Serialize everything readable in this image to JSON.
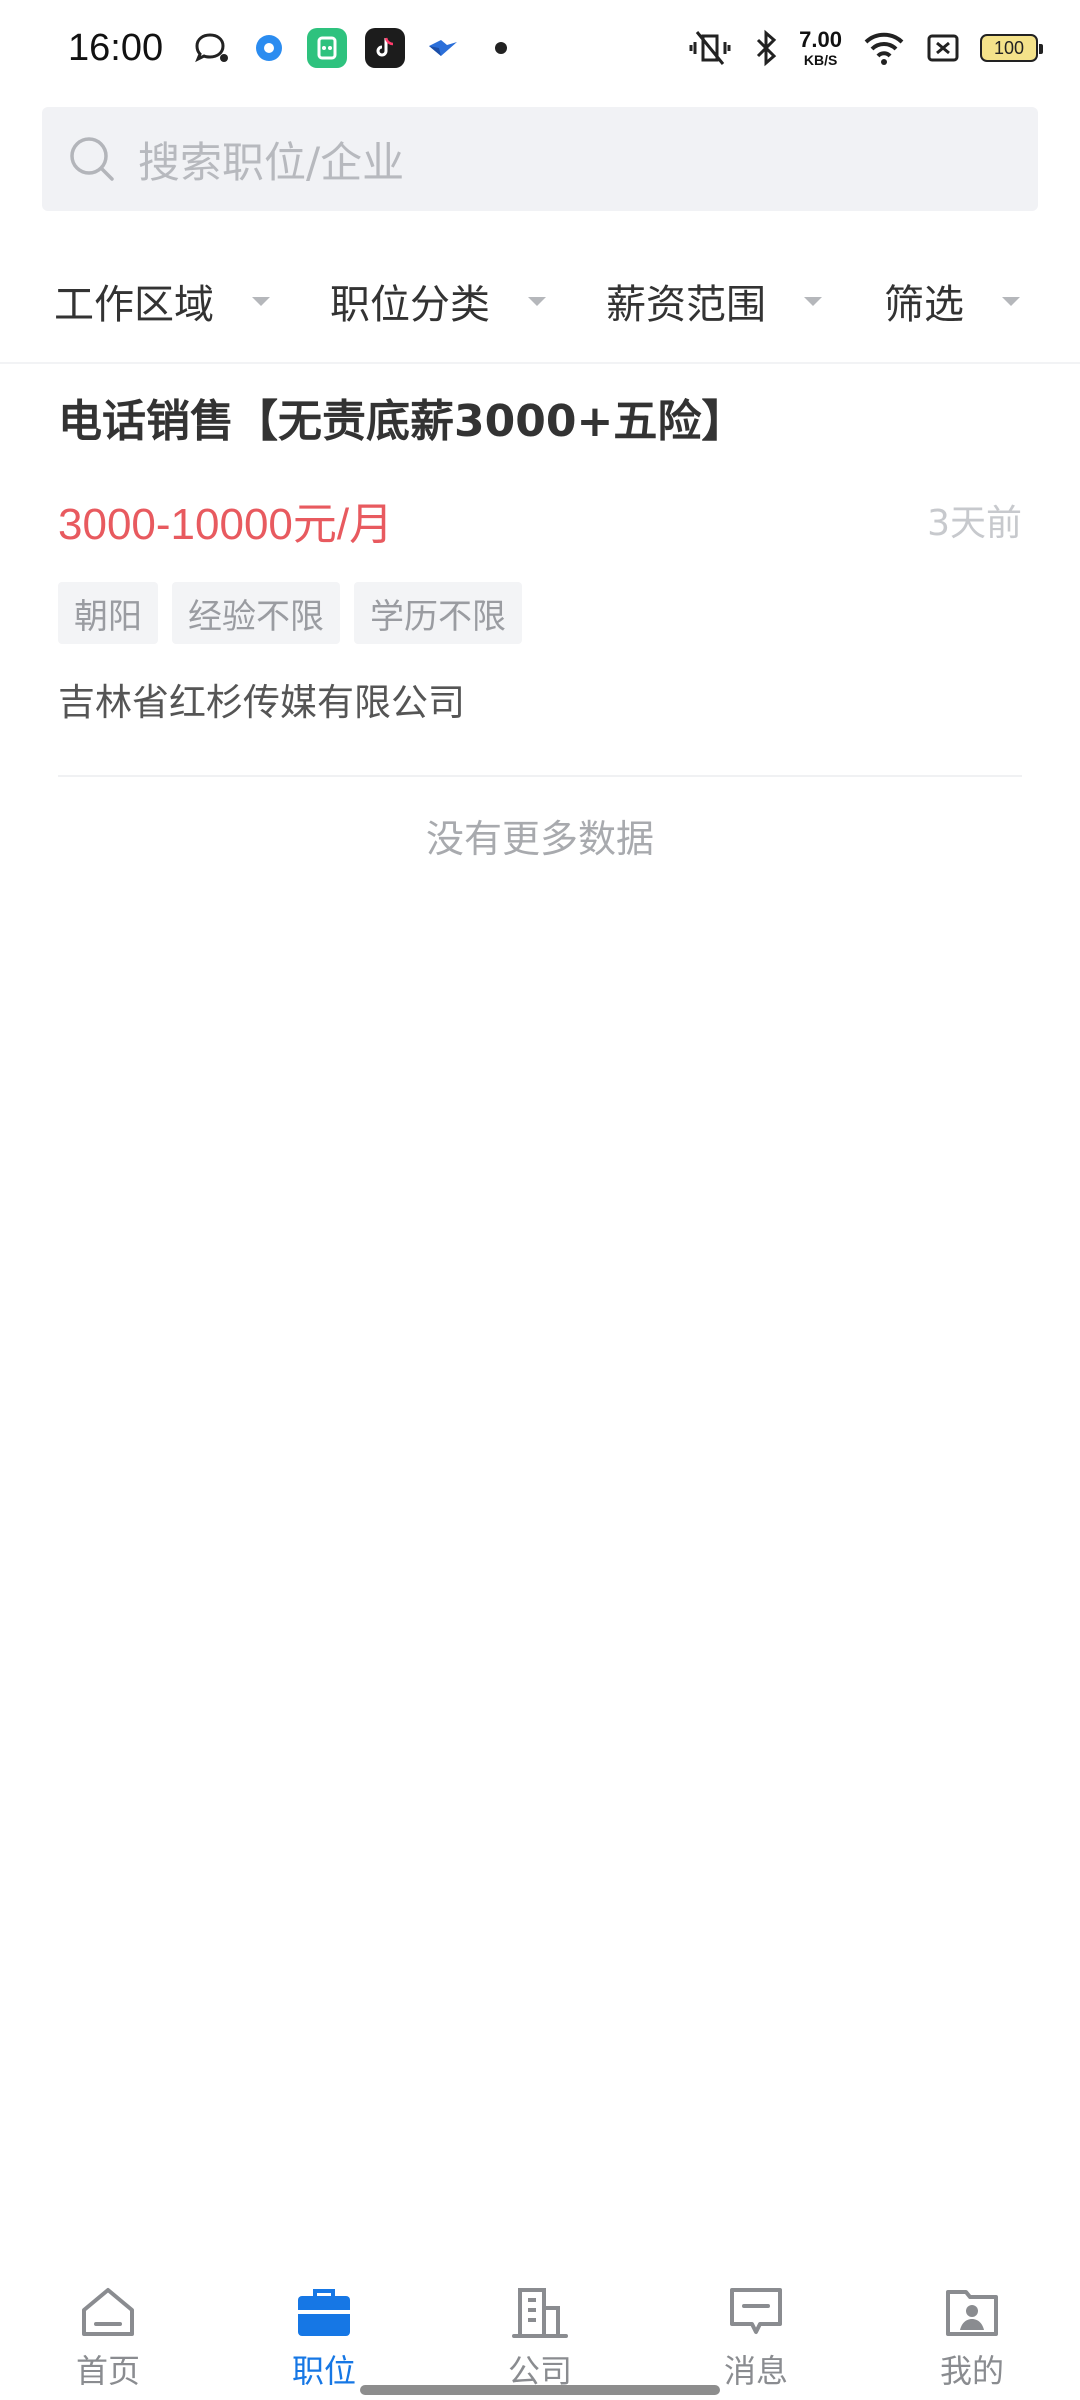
{
  "status_bar": {
    "time": "16:00",
    "net_speed_value": "7.00",
    "net_speed_unit": "KB/S",
    "battery": "100",
    "left_icons": [
      "chat-bubble-icon",
      "blue-circle-app-icon",
      "green-app-icon",
      "tiktok-icon",
      "bird-app-icon",
      "dot-icon"
    ],
    "right_icons": [
      "vibrate-mute-icon",
      "bluetooth-icon",
      "wifi-icon",
      "sim-none-icon",
      "battery-icon"
    ]
  },
  "search": {
    "placeholder": "搜索职位/企业"
  },
  "filters": [
    {
      "label": "工作区域"
    },
    {
      "label": "职位分类"
    },
    {
      "label": "薪资范围"
    },
    {
      "label": "筛选"
    }
  ],
  "job": {
    "title": "电话销售【无责底薪3000+五险】",
    "salary": "3000-10000元/月",
    "posted": "3天前",
    "tags": [
      "朝阳",
      "经验不限",
      "学历不限"
    ],
    "company": "吉林省红杉传媒有限公司"
  },
  "list_footer": "没有更多数据",
  "tabs": [
    {
      "label": "首页",
      "icon": "home-icon",
      "active": false
    },
    {
      "label": "职位",
      "icon": "briefcase-icon",
      "active": true
    },
    {
      "label": "公司",
      "icon": "building-icon",
      "active": false
    },
    {
      "label": "消息",
      "icon": "message-icon",
      "active": false
    },
    {
      "label": "我的",
      "icon": "profile-icon",
      "active": false
    }
  ],
  "colors": {
    "accent": "#1677e5",
    "salary": "#e85a5f",
    "inactive": "#8a8c90"
  }
}
